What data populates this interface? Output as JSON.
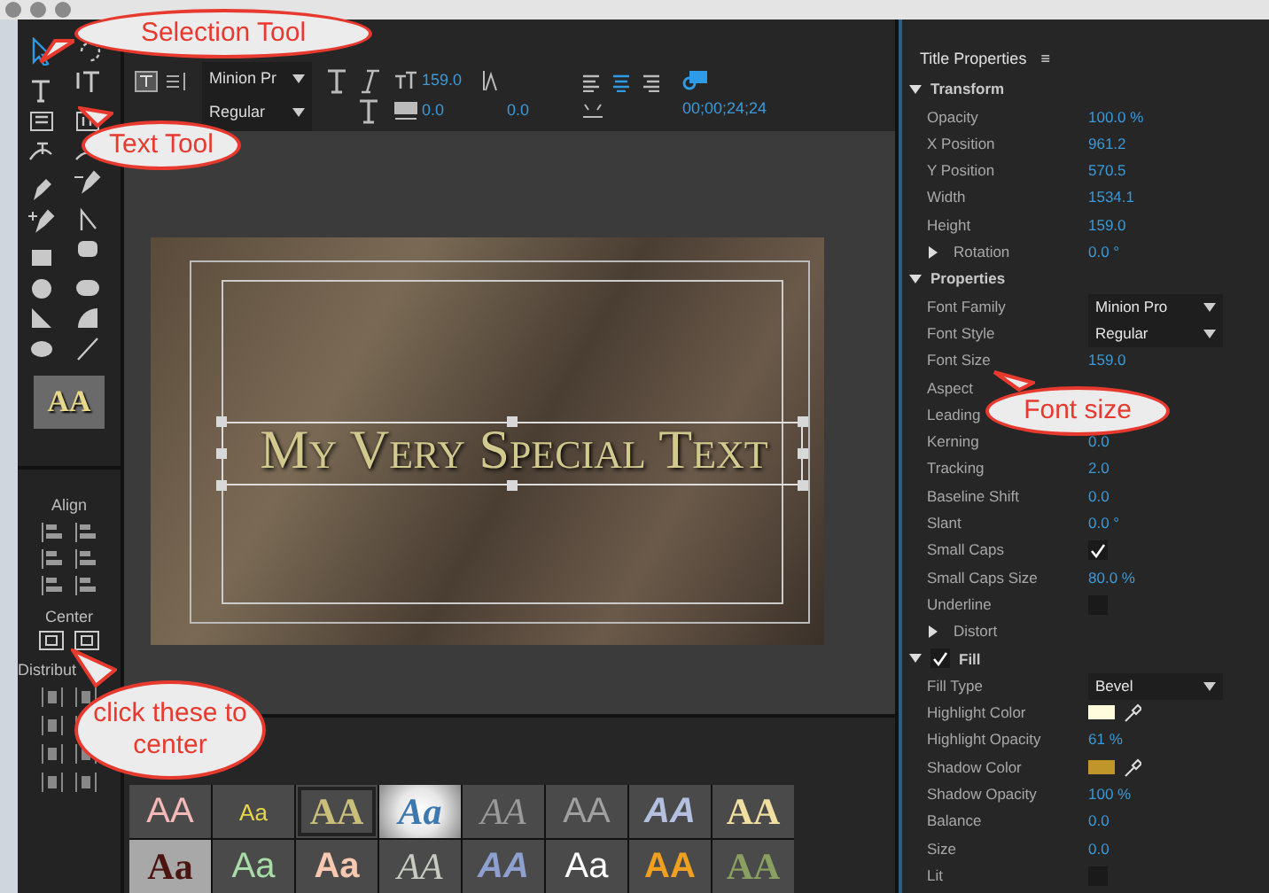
{
  "tools": [
    {
      "kind": "select",
      "selected": true
    },
    {
      "kind": "rotate",
      "selected": false
    },
    {
      "kind": "type",
      "selected": false
    },
    {
      "kind": "vtype",
      "selected": false
    },
    {
      "kind": "areatype",
      "selected": false
    },
    {
      "kind": "vareatype",
      "selected": false
    },
    {
      "kind": "pathtype",
      "selected": false
    },
    {
      "kind": "vpathtype",
      "selected": false
    },
    {
      "kind": "pen",
      "selected": false
    },
    {
      "kind": "delpen",
      "selected": false
    },
    {
      "kind": "addpen",
      "selected": false
    },
    {
      "kind": "convert",
      "selected": false
    },
    {
      "kind": "rect",
      "selected": false
    },
    {
      "kind": "roundrect",
      "selected": false
    },
    {
      "kind": "clipped",
      "selected": false
    },
    {
      "kind": "rounded",
      "selected": false
    },
    {
      "kind": "wedge",
      "selected": false
    },
    {
      "kind": "arc",
      "selected": false
    },
    {
      "kind": "ellipse",
      "selected": false
    },
    {
      "kind": "line",
      "selected": false
    }
  ],
  "style_preview": {
    "label": "AA"
  },
  "align_panel": {
    "align_label": "Align",
    "center_label": "Center",
    "distribute_label": "Distribut"
  },
  "toolbar": {
    "font_family": "Minion Pr",
    "font_style": "Regular",
    "font_size": "159.0",
    "kerning": "0.0",
    "tracking": "0.0",
    "timecode": "00;00;24;24",
    "text_align": [
      {
        "selected": false
      },
      {
        "selected": true
      },
      {
        "selected": false
      }
    ]
  },
  "canvas": {
    "title_text": "My Very Special Text"
  },
  "styles": [
    {
      "label": "AA",
      "kind": "sans",
      "color": "#f4b8b8",
      "selected": false
    },
    {
      "label": "Aa",
      "kind": "small",
      "color": "#e6d84a",
      "selected": false
    },
    {
      "label": "AA",
      "kind": "serif",
      "color": "#c9bf7a",
      "selected": true
    },
    {
      "label": "Aa",
      "kind": "glow",
      "color": "#3e78b0",
      "selected": false
    },
    {
      "label": "AA",
      "kind": "italic",
      "color": "#9a9a9a",
      "selected": false
    },
    {
      "label": "AA",
      "kind": "sans",
      "color": "#a0a0a0",
      "selected": false
    },
    {
      "label": "AA",
      "kind": "bolditalic",
      "color": "#b4c0e0",
      "selected": false
    },
    {
      "label": "AA",
      "kind": "serif",
      "color": "#f0dfa0",
      "selected": false
    },
    {
      "label": "Aa",
      "kind": "darkserif",
      "color": "#4a1410",
      "selected": false
    },
    {
      "label": "Aa",
      "kind": "sans",
      "color": "#a8dca8",
      "selected": false
    },
    {
      "label": "Aa",
      "kind": "bold",
      "color": "#f8c8b0",
      "selected": false
    },
    {
      "label": "AA",
      "kind": "italic",
      "color": "#c8ccc0",
      "selected": false
    },
    {
      "label": "AA",
      "kind": "bolditalic",
      "color": "#8ea0d0",
      "selected": false
    },
    {
      "label": "Aa",
      "kind": "sans",
      "color": "#ffffff",
      "selected": false
    },
    {
      "label": "AA",
      "kind": "bold",
      "color": "#f0a020",
      "selected": false
    },
    {
      "label": "AA",
      "kind": "serif",
      "color": "#8aa060",
      "selected": false
    }
  ],
  "properties": {
    "title": "Title Properties",
    "menu": "≡",
    "rows": [
      {
        "kind": "section",
        "label": "Transform",
        "expanded": true
      },
      {
        "kind": "value",
        "label": "Opacity",
        "value": "100.0 %"
      },
      {
        "kind": "value",
        "label": "X Position",
        "value": "961.2"
      },
      {
        "kind": "value",
        "label": "Y Position",
        "value": "570.5"
      },
      {
        "kind": "value",
        "label": "Width",
        "value": "1534.1"
      },
      {
        "kind": "value",
        "label": "Height",
        "value": "159.0"
      },
      {
        "kind": "group",
        "label": "Rotation",
        "value": "0.0 °",
        "expanded": false
      },
      {
        "kind": "section",
        "label": "Properties",
        "expanded": true
      },
      {
        "kind": "dropdown",
        "label": "Font Family",
        "value": "Minion Pro"
      },
      {
        "kind": "dropdown",
        "label": "Font Style",
        "value": "Regular"
      },
      {
        "kind": "value",
        "label": "Font Size",
        "value": "159.0"
      },
      {
        "kind": "value",
        "label": "Aspect"
      },
      {
        "kind": "value",
        "label": "Leading"
      },
      {
        "kind": "value",
        "label": "Kerning",
        "value": "0.0"
      },
      {
        "kind": "value",
        "label": "Tracking",
        "value": "2.0"
      },
      {
        "kind": "value",
        "label": "Baseline Shift",
        "value": "0.0"
      },
      {
        "kind": "value",
        "label": "Slant",
        "value": "0.0 °"
      },
      {
        "kind": "checkbox",
        "label": "Small Caps",
        "checked": true
      },
      {
        "kind": "value",
        "label": "Small Caps Size",
        "value": "80.0 %"
      },
      {
        "kind": "checkbox",
        "label": "Underline",
        "checked": false
      },
      {
        "kind": "group",
        "label": "Distort",
        "expanded": false
      },
      {
        "kind": "checksection",
        "label": "Fill",
        "expanded": true,
        "checked": true
      },
      {
        "kind": "dropdown",
        "label": "Fill Type",
        "value": "Bevel"
      },
      {
        "kind": "color",
        "label": "Highlight Color",
        "color": "#fffbdc"
      },
      {
        "kind": "value",
        "label": "Highlight Opacity",
        "value": "61 %"
      },
      {
        "kind": "color",
        "label": "Shadow Color",
        "color": "#c0962a"
      },
      {
        "kind": "value",
        "label": "Shadow Opacity",
        "value": "100 %"
      },
      {
        "kind": "value",
        "label": "Balance",
        "value": "0.0"
      },
      {
        "kind": "value",
        "label": "Size",
        "value": "0.0"
      },
      {
        "kind": "checkbox",
        "label": "Lit",
        "checked": false
      }
    ]
  },
  "callouts": [
    {
      "text": "Selection Tool"
    },
    {
      "text": "Text Tool"
    },
    {
      "text": "Font size"
    },
    {
      "text": "click these to center"
    }
  ]
}
